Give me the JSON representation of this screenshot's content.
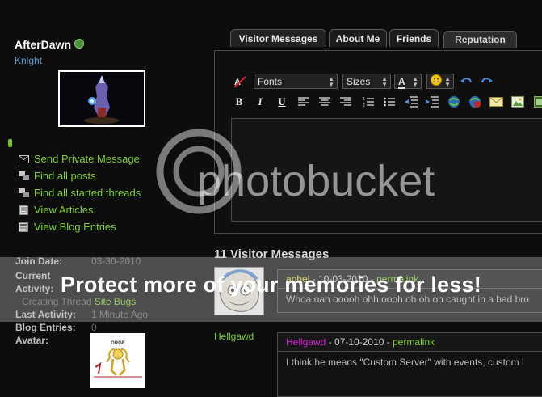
{
  "profile": {
    "username": "AfterDawn",
    "rank": "Knight",
    "actions": [
      {
        "label": "Send Private Message",
        "icon": "envelope-icon"
      },
      {
        "label": "Find all posts",
        "icon": "posts-icon"
      },
      {
        "label": "Find all started threads",
        "icon": "threads-icon"
      },
      {
        "label": "View Articles",
        "icon": "articles-icon"
      },
      {
        "label": "View Blog Entries",
        "icon": "blog-icon"
      }
    ],
    "stats": {
      "join_date_label": "Join Date:",
      "join_date_value": "03-30-2010",
      "current_activity_label_1": "Current",
      "current_activity_label_2": "Activity:",
      "current_activity_prefix": "Creating Thread",
      "current_activity_link": "Site Bugs",
      "last_activity_label": "Last Activity:",
      "last_activity_value": "1 Minute Ago",
      "blog_entries_label": "Blog Entries:",
      "blog_entries_value": "0",
      "avatar_label": "Avatar:",
      "avatar_caption": "ORGE"
    }
  },
  "tabs": [
    {
      "label": "Visitor Messages"
    },
    {
      "label": "About Me"
    },
    {
      "label": "Friends"
    },
    {
      "label": "Reputation"
    }
  ],
  "editor": {
    "font_select": "Fonts",
    "size_select": "Sizes",
    "color_letter": "A"
  },
  "visitor_messages": {
    "title": "11 Visitor Messages",
    "items": [
      {
        "author": "aphel",
        "author_color": "#e8e84a",
        "date": "10-03-2010",
        "permalink": "permalink",
        "body": "Whoa oah ooooh ohh oooh oh oh oh caught in a bad bro"
      },
      {
        "author": "Hellgawd",
        "author_color": "#d81ad8",
        "date": "07-10-2010",
        "permalink": "permalink",
        "body": "I think he means \"Custom Server\" with events, custom i"
      }
    ],
    "side_author": "Hellgawd"
  },
  "watermark": {
    "logo_text": "photobucket",
    "band_text": "Protect more of your memories for less!"
  },
  "colors": {
    "link": "#7fd02a",
    "rank": "#5a9fd4",
    "background": "#0d0d0d"
  }
}
